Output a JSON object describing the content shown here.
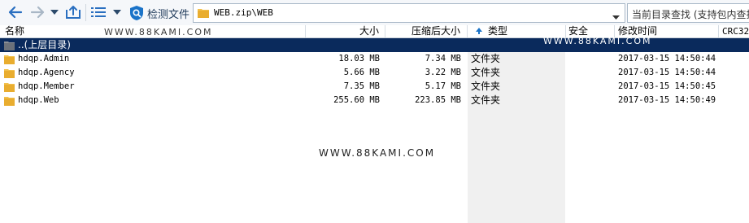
{
  "toolbar": {
    "check_label": "检测文件",
    "path": "WEB.zip\\WEB",
    "search_placeholder": "当前目录查找 (支持包内查找)"
  },
  "columns": {
    "name": "名称",
    "size": "大小",
    "compressed": "压缩后大小",
    "type": "类型",
    "security": "安全",
    "modified": "修改时间",
    "crc": "CRC32"
  },
  "parent_row": {
    "name": "..(上层目录)"
  },
  "files": [
    {
      "name": "hdqp.Admin",
      "size": "18.03 MB",
      "compressed": "7.34 MB",
      "type": "文件夹",
      "modified": "2017-03-15 14:50:44"
    },
    {
      "name": "hdqp.Agency",
      "size": "5.66 MB",
      "compressed": "3.22 MB",
      "type": "文件夹",
      "modified": "2017-03-15 14:50:44"
    },
    {
      "name": "hdqp.Member",
      "size": "7.35 MB",
      "compressed": "5.17 MB",
      "type": "文件夹",
      "modified": "2017-03-15 14:50:45"
    },
    {
      "name": "hdqp.Web",
      "size": "255.60 MB",
      "compressed": "223.85 MB",
      "type": "文件夹",
      "modified": "2017-03-15 14:50:49"
    }
  ],
  "watermark": "WWW.88KAMI.COM",
  "colors": {
    "selected_row": "#0a2a5c",
    "accent": "#1a73c8",
    "folder": "#f2c14e"
  }
}
